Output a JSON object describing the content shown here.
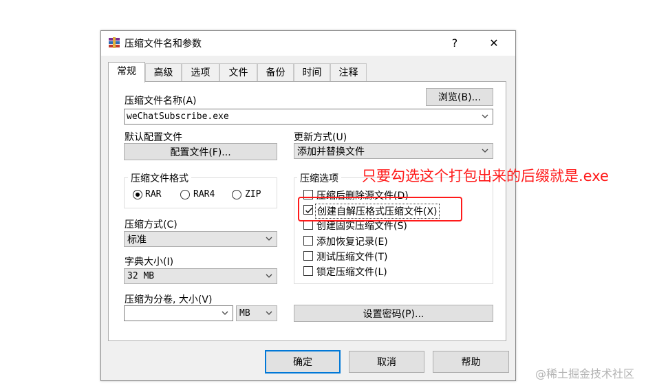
{
  "window": {
    "title": "压缩文件名和参数",
    "help_glyph": "?",
    "close_glyph": "✕"
  },
  "tabs": [
    {
      "label": "常规",
      "active": true
    },
    {
      "label": "高级"
    },
    {
      "label": "选项"
    },
    {
      "label": "文件"
    },
    {
      "label": "备份"
    },
    {
      "label": "时间"
    },
    {
      "label": "注释"
    }
  ],
  "archive_name": {
    "label": "压缩文件名称(A)",
    "browse_label": "浏览(B)...",
    "value": "weChatSubscribe.exe"
  },
  "profile": {
    "label": "默认配置文件",
    "button_label": "配置文件(F)..."
  },
  "update_mode": {
    "label": "更新方式(U)",
    "value": "添加并替换文件"
  },
  "archive_format": {
    "title": "压缩文件格式",
    "options": [
      "RAR",
      "RAR4",
      "ZIP"
    ],
    "selected": "RAR"
  },
  "compression_method": {
    "label": "压缩方式(C)",
    "value": "标准"
  },
  "dictionary_size": {
    "label": "字典大小(I)",
    "value": "32 MB"
  },
  "split_volumes": {
    "label": "压缩为分卷, 大小(V)",
    "value": "",
    "unit": "MB"
  },
  "set_password_label": "设置密码(P)...",
  "compression_options": {
    "title": "压缩选项",
    "items": [
      {
        "label": "压缩后删除源文件(D)",
        "checked": false
      },
      {
        "label": "创建自解压格式压缩文件(X)",
        "checked": true
      },
      {
        "label": "创建固实压缩文件(S)",
        "checked": false
      },
      {
        "label": "添加恢复记录(E)",
        "checked": false
      },
      {
        "label": "测试压缩文件(T)",
        "checked": false
      },
      {
        "label": "锁定压缩文件(L)",
        "checked": false
      }
    ]
  },
  "footer": {
    "ok": "确定",
    "cancel": "取消",
    "help": "帮助"
  },
  "annotation": {
    "text": "只要勾选这个打包出来的后缀就是.exe",
    "color": "#ff1a1a"
  },
  "watermark": "@稀土掘金技术社区",
  "colors": {
    "accent": "#0078d7",
    "dialog_bg": "#f0f0f0",
    "annotation_red": "#ff1a1a"
  }
}
